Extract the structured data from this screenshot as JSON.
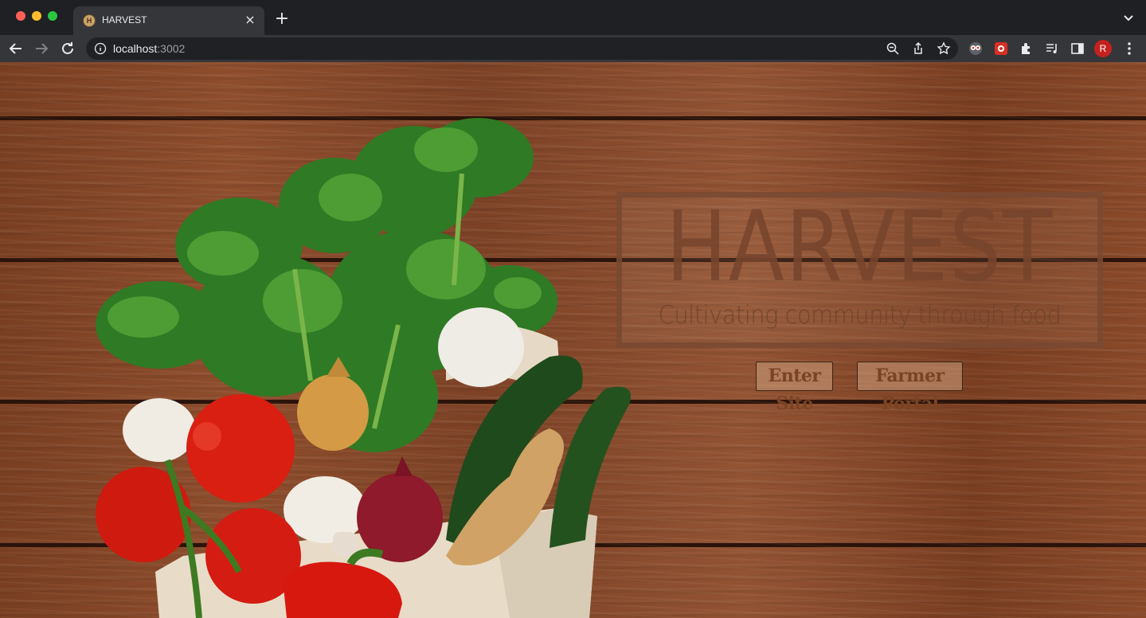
{
  "browser": {
    "tab": {
      "title": "HARVEST",
      "favicon_letter": "H"
    },
    "new_tab_label": "+",
    "close_label": "×",
    "address": {
      "host": "localhost",
      "port": ":3002"
    },
    "profile_initial": "R"
  },
  "page": {
    "title": "HARVEST",
    "subtitle": "Cultivating community through food",
    "buttons": {
      "enter": "Enter Site",
      "farmer": "Farmer Portal"
    }
  },
  "colors": {
    "wood": "#8a4a2a",
    "hero_text": "#76442c",
    "button_text": "#7a4322"
  }
}
